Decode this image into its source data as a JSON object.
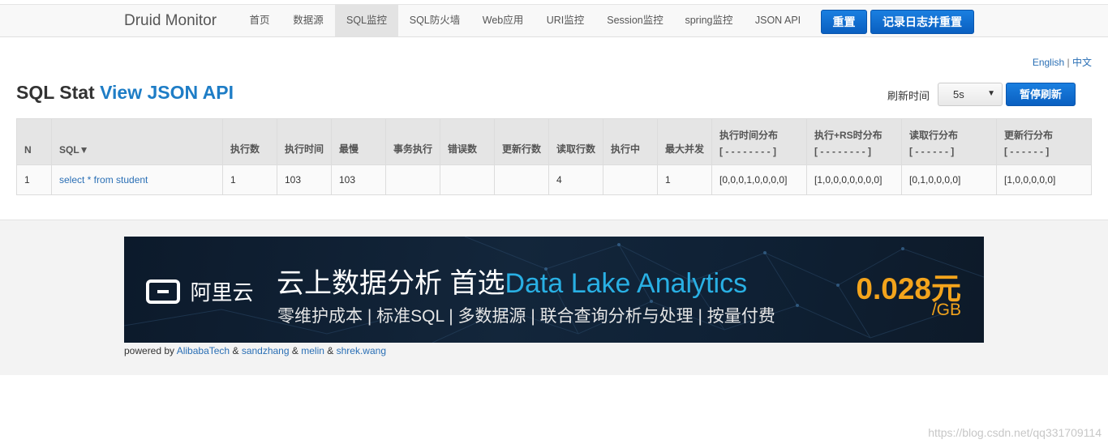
{
  "nav": {
    "brand": "Druid Monitor",
    "items": [
      {
        "label": "首页"
      },
      {
        "label": "数据源"
      },
      {
        "label": "SQL监控"
      },
      {
        "label": "SQL防火墙"
      },
      {
        "label": "Web应用"
      },
      {
        "label": "URI监控"
      },
      {
        "label": "Session监控"
      },
      {
        "label": "spring监控"
      },
      {
        "label": "JSON API"
      }
    ],
    "active_item": "SQL监控",
    "reset_label": "重置",
    "log_reset_label": "记录日志并重置"
  },
  "lang": {
    "english": "English",
    "sep": "|",
    "chinese": "中文"
  },
  "page": {
    "title": "SQL Stat",
    "title_link": "View JSON API",
    "refresh_label": "刷新时间",
    "refresh_value": "5s",
    "pause_label": "暂停刷新"
  },
  "table": {
    "headers": {
      "n": "N",
      "sql": "SQL▼",
      "exec_count": "执行数",
      "exec_time": "执行时间",
      "slowest": "最慢",
      "tx_exec": "事务执行",
      "errors": "错误数",
      "update_rows": "更新行数",
      "read_rows": "读取行数",
      "running": "执行中",
      "max_concurrent": "最大并发",
      "exec_time_dist": "执行时间分布",
      "exec_time_dist_sub": "[ - - - - - - - - ]",
      "exec_rs_dist": "执行+RS时分布",
      "exec_rs_dist_sub": "[ - - - - - - - - ]",
      "read_rows_dist": "读取行分布",
      "read_rows_dist_sub": "[ - - - - - - ]",
      "update_rows_dist": "更新行分布",
      "update_rows_dist_sub": "[ - - - - - - ]"
    },
    "rows": [
      {
        "n": "1",
        "sql": "select * from student",
        "exec_count": "1",
        "exec_time": "103",
        "slowest": "103",
        "tx_exec": "",
        "errors": "",
        "update_rows": "",
        "read_rows": "4",
        "running": "",
        "max_concurrent": "1",
        "exec_time_dist": "[0,0,0,1,0,0,0,0]",
        "exec_rs_dist": "[1,0,0,0,0,0,0,0]",
        "read_rows_dist": "[0,1,0,0,0,0]",
        "update_rows_dist": "[1,0,0,0,0,0]"
      }
    ]
  },
  "banner": {
    "logo_text": "阿里云",
    "title_cn": "云上数据分析 首选",
    "title_en": "Data Lake Analytics",
    "subtitle": "零维护成本 | 标准SQL | 多数据源 | 联合查询分析与处理 | 按量付费",
    "price": "0.028元",
    "unit": "/GB"
  },
  "footer": {
    "powered_by": "powered by",
    "authors": [
      "AlibabaTech",
      "sandzhang",
      "melin",
      "shrek.wang"
    ],
    "amp": "&"
  },
  "watermark": "https://blog.csdn.net/qq331709114",
  "colors": {
    "primary_button": "#0a5fc0",
    "link": "#2a6fb5",
    "title_link": "#1e7dc6",
    "banner_bg": "#0c1a2b",
    "banner_accent": "#29b0e4",
    "banner_price": "#f3a41c"
  }
}
